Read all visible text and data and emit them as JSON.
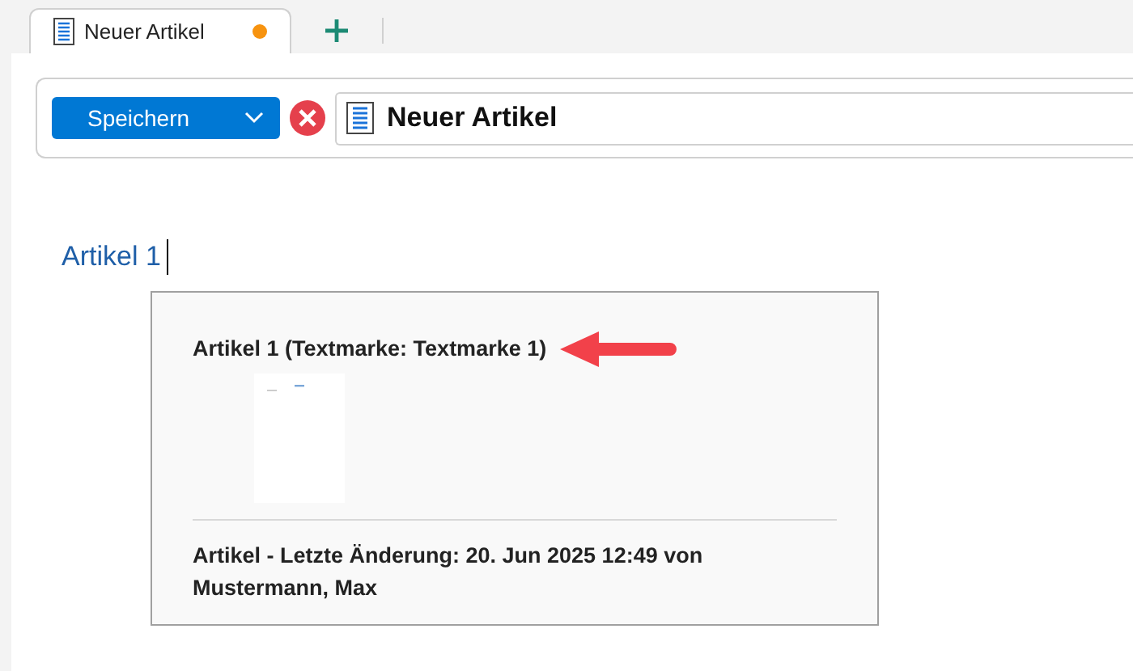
{
  "tabs": [
    {
      "label": "Neuer Artikel",
      "selected": true,
      "modified": true
    }
  ],
  "toolbar": {
    "save_button": "Speichern",
    "title": "Neuer Artikel"
  },
  "document": {
    "heading": "Artikel 1",
    "card": {
      "title": "Artikel 1 (Textmarke: Textmarke 1)",
      "footer": "Artikel - Letzte Änderung: 20. Jun 2025 12:49 von Mustermann, Max"
    }
  }
}
